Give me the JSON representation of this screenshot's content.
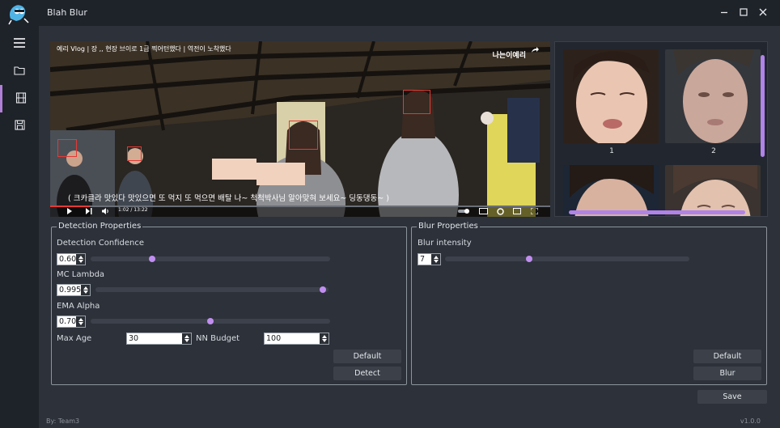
{
  "app": {
    "title": "Blah Blur",
    "author": "By: Team3",
    "version": "v1.0.0"
  },
  "icons": {
    "menu": "hamburger-icon",
    "open": "folder-icon",
    "video": "film-icon",
    "save": "save-icon",
    "minimize": "minimize-icon",
    "maximize": "maximize-icon",
    "close": "close-icon"
  },
  "video": {
    "title": "예리 Vlog | 장 ,, 현장 브이로 1급 찍어턴했다 | 역전이 노착했다",
    "watermark": "나는이예리",
    "subtitle": "( 크카클라 맛있다 맛있으면 또 먹지 또 먹으면 배탈 나~ 척척박사님 알아맞혀 보세요~ 딩동댕동~ )",
    "time": "1:02 / 13:22"
  },
  "faces": [
    {
      "label": "1"
    },
    {
      "label": "2"
    },
    {
      "label": ""
    },
    {
      "label": ""
    }
  ],
  "detection": {
    "title": "Detection Properties",
    "confidence_label": "Detection Confidence",
    "confidence_value": "0.60",
    "confidence_level": 0.25,
    "mc_lambda_label": "MC Lambda",
    "mc_lambda_value": "0.995",
    "mc_lambda_level": 0.99,
    "ema_alpha_label": "EMA Alpha",
    "ema_alpha_value": "0.70",
    "ema_alpha_level": 0.5,
    "max_age_label": "Max Age",
    "max_age_value": "30",
    "nn_budget_label": "NN Budget",
    "nn_budget_value": "100",
    "default_label": "Default",
    "detect_label": "Detect"
  },
  "blur": {
    "title": "Blur Properties",
    "intensity_label": "Blur intensity",
    "intensity_value": "7",
    "intensity_level": 0.34,
    "default_label": "Default",
    "blur_label": "Blur"
  },
  "save_label": "Save",
  "colors": {
    "accent": "#c18ef0",
    "background": "#2c313a",
    "sidebar": "#1e2229",
    "detection_box": "#e53935"
  }
}
